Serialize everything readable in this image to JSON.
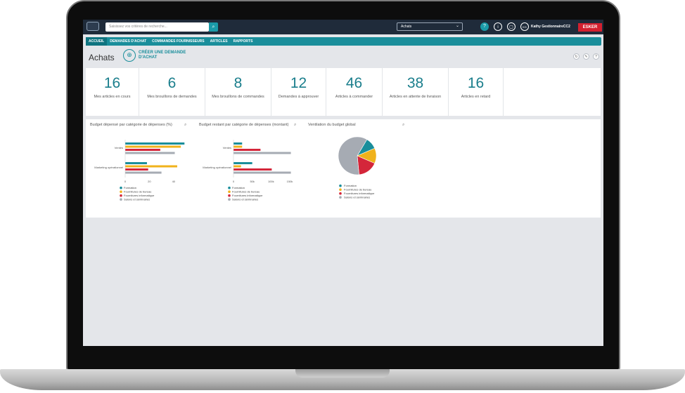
{
  "search": {
    "placeholder": "Saisissez vos critères de recherche..."
  },
  "app_select": {
    "value": "Achats"
  },
  "user": {
    "initials": "KG",
    "name": "Kathy GestionnaireCC2"
  },
  "brand": {
    "name": "ESKER"
  },
  "nav": {
    "items": [
      "ACCUEIL",
      "DEMANDES D'ACHAT",
      "COMMANDES FOURNISSEURS",
      "ARTICLES",
      "RAPPORTS"
    ],
    "active": "ACCUEIL"
  },
  "page": {
    "title": "Achats",
    "create_label": "CRÉER UNE DEMANDE D'ACHAT"
  },
  "kpis": [
    {
      "value": "16",
      "label": "Mes articles en cours"
    },
    {
      "value": "6",
      "label": "Mes brouillons de demandes"
    },
    {
      "value": "8",
      "label": "Mes brouillons de commandes"
    },
    {
      "value": "12",
      "label": "Demandes à approuver"
    },
    {
      "value": "46",
      "label": "Articles à commander"
    },
    {
      "value": "38",
      "label": "Articles en attente de livraison"
    },
    {
      "value": "16",
      "label": "Articles en retard"
    }
  ],
  "colors": {
    "Formation": "#1a8e9b",
    "Fournitures de bureau": "#f0b21b",
    "Fournitures informatique": "#d4263a",
    "Salons et séminaires": "#a6abb3"
  },
  "chart_data": [
    {
      "type": "bar",
      "orientation": "horizontal",
      "title": "Budget dépensé par catégorie de dépenses (%)",
      "categories": [
        "Ventes",
        "Marketing opérationnel"
      ],
      "x_ticks": [
        "0",
        "20",
        "40"
      ],
      "xlim": [
        0,
        50
      ],
      "series": [
        {
          "name": "Formation",
          "values": [
            49,
            18
          ]
        },
        {
          "name": "Fournitures de bureau",
          "values": [
            46,
            43
          ]
        },
        {
          "name": "Fournitures informatique",
          "values": [
            29,
            19
          ]
        },
        {
          "name": "Salons et séminaires",
          "values": [
            41,
            30
          ]
        }
      ]
    },
    {
      "type": "bar",
      "orientation": "horizontal",
      "title": "Budget restant par catégorie de dépenses (montant)",
      "categories": [
        "Ventes",
        "Marketing opérationnel"
      ],
      "x_ticks": [
        "0",
        "50k",
        "100k",
        "150k"
      ],
      "xlim": [
        0,
        165000
      ],
      "series": [
        {
          "name": "Formation",
          "values": [
            23000,
            50000
          ]
        },
        {
          "name": "Fournitures de bureau",
          "values": [
            23000,
            20000
          ]
        },
        {
          "name": "Fournitures informatique",
          "values": [
            72000,
            102000
          ]
        },
        {
          "name": "Salons et séminaires",
          "values": [
            153000,
            153000
          ]
        }
      ]
    },
    {
      "type": "pie",
      "title": "Ventilation du budget global",
      "series": [
        {
          "name": "Formation",
          "value": 10
        },
        {
          "name": "Fournitures de bureau",
          "value": 13
        },
        {
          "name": "Fournitures informatique",
          "value": 17
        },
        {
          "name": "Salons et séminaires",
          "value": 60
        }
      ]
    }
  ]
}
